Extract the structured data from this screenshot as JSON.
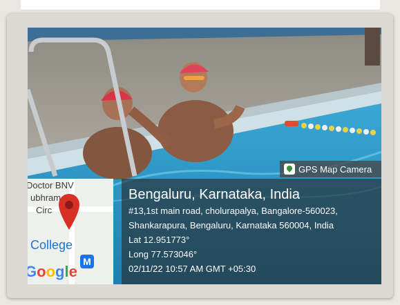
{
  "overlay": {
    "app_badge": "GPS Map Camera",
    "place": "Bengaluru, Karnataka, India",
    "address_line1": "#13,1st main road, cholurapalya, Bangalore-560023,",
    "address_line2": "Shankarapura, Bengaluru, Karnataka 560004, India",
    "latitude": "Lat 12.951773°",
    "longitude": "Long 77.573046°",
    "timestamp": "02/11/22 10:57 AM GMT +05:30"
  },
  "map": {
    "label_top": "Doctor BNV",
    "label_mid": "ubhram",
    "label_circle": "Circ",
    "label_college": "College",
    "metro_mark": "M",
    "logo_letters": [
      "G",
      "o",
      "o",
      "g",
      "l",
      "e"
    ],
    "pin_icon": "map-pin-icon",
    "pin_color": "#d93025"
  },
  "scene": {
    "description_items": [
      "swimming-pool",
      "swimmer-left",
      "swimmer-right",
      "pool-ladder",
      "lane-rope"
    ]
  }
}
